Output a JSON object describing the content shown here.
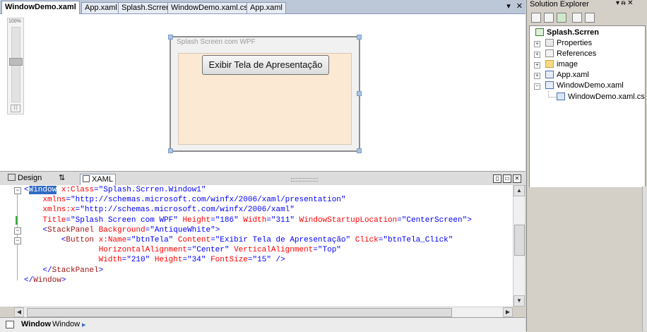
{
  "document_tabs": [
    {
      "label": "WindowDemo.xaml",
      "active": true
    },
    {
      "label": "App.xaml",
      "active": false
    },
    {
      "label": "Splash.Scrren",
      "active": false
    },
    {
      "label": "WindowDemo.xaml.cs",
      "active": false
    },
    {
      "label": "App.xaml",
      "active": false
    }
  ],
  "tab_controls": {
    "dropdown": "▾",
    "close": "✕"
  },
  "designer": {
    "zoom_label": "100%",
    "zoom_fit": "[:]",
    "window_title": "Splash Screen com WPF",
    "button_label": "Exibir Tela de Apresentação",
    "client_color": "#fbe9d4"
  },
  "view_tabs": {
    "design": "Design",
    "swap": "⇅",
    "xaml": "XAML"
  },
  "code": {
    "lines": [
      [
        {
          "t": "<",
          "c": "blue"
        },
        {
          "t": "Window",
          "c": "sel"
        },
        {
          "t": " x:Class",
          "c": "red"
        },
        {
          "t": "=",
          "c": "blue"
        },
        {
          "t": "\"Splash.Scrren.Window1\"",
          "c": "blue"
        }
      ],
      [
        {
          "t": "    xmlns",
          "c": "red"
        },
        {
          "t": "=",
          "c": "blue"
        },
        {
          "t": "\"http://schemas.microsoft.com/winfx/2006/xaml/presentation\"",
          "c": "blue"
        }
      ],
      [
        {
          "t": "    xmlns:x",
          "c": "red"
        },
        {
          "t": "=",
          "c": "blue"
        },
        {
          "t": "\"http://schemas.microsoft.com/winfx/2006/xaml\"",
          "c": "blue"
        }
      ],
      [
        {
          "t": "    Title",
          "c": "red"
        },
        {
          "t": "=",
          "c": "blue"
        },
        {
          "t": "\"Splash Screen com WPF\"",
          "c": "blue"
        },
        {
          "t": " Height",
          "c": "red"
        },
        {
          "t": "=",
          "c": "blue"
        },
        {
          "t": "\"186\"",
          "c": "blue"
        },
        {
          "t": " Width",
          "c": "red"
        },
        {
          "t": "=",
          "c": "blue"
        },
        {
          "t": "\"311\"",
          "c": "blue"
        },
        {
          "t": " WindowStartupLocation",
          "c": "red"
        },
        {
          "t": "=",
          "c": "blue"
        },
        {
          "t": "\"CenterScreen\"",
          "c": "blue"
        },
        {
          "t": ">",
          "c": "blue"
        }
      ],
      [
        {
          "t": "    <",
          "c": "blue"
        },
        {
          "t": "StackPanel",
          "c": "brown"
        },
        {
          "t": " Background",
          "c": "red"
        },
        {
          "t": "=",
          "c": "blue"
        },
        {
          "t": "\"AntiqueWhite\"",
          "c": "blue"
        },
        {
          "t": ">",
          "c": "blue"
        }
      ],
      [
        {
          "t": "        <",
          "c": "blue"
        },
        {
          "t": "Button",
          "c": "brown"
        },
        {
          "t": " x:Name",
          "c": "red"
        },
        {
          "t": "=",
          "c": "blue"
        },
        {
          "t": "\"btnTela\"",
          "c": "blue"
        },
        {
          "t": " Content",
          "c": "red"
        },
        {
          "t": "=",
          "c": "blue"
        },
        {
          "t": "\"Exibir Tela de Apresentação\"",
          "c": "blue"
        },
        {
          "t": " Click",
          "c": "red"
        },
        {
          "t": "=",
          "c": "blue"
        },
        {
          "t": "\"btnTela_Click\"",
          "c": "blue"
        }
      ],
      [
        {
          "t": "                HorizontalAlignment",
          "c": "red"
        },
        {
          "t": "=",
          "c": "blue"
        },
        {
          "t": "\"Center\"",
          "c": "blue"
        },
        {
          "t": " VerticalAlignment",
          "c": "red"
        },
        {
          "t": "=",
          "c": "blue"
        },
        {
          "t": "\"Top\"",
          "c": "blue"
        }
      ],
      [
        {
          "t": "                Width",
          "c": "red"
        },
        {
          "t": "=",
          "c": "blue"
        },
        {
          "t": "\"210\"",
          "c": "blue"
        },
        {
          "t": " Height",
          "c": "red"
        },
        {
          "t": "=",
          "c": "blue"
        },
        {
          "t": "\"34\"",
          "c": "blue"
        },
        {
          "t": " FontSize",
          "c": "red"
        },
        {
          "t": "=",
          "c": "blue"
        },
        {
          "t": "\"15\"",
          "c": "blue"
        },
        {
          "t": " />",
          "c": "blue"
        }
      ],
      [
        {
          "t": "    </",
          "c": "blue"
        },
        {
          "t": "StackPanel",
          "c": "brown"
        },
        {
          "t": ">",
          "c": "blue"
        }
      ],
      [
        {
          "t": "</",
          "c": "blue"
        },
        {
          "t": "Window",
          "c": "brown"
        },
        {
          "t": ">",
          "c": "blue"
        }
      ]
    ]
  },
  "status": {
    "crumb_bold": "Window",
    "crumb_normal": "Window",
    "arrow": "▸"
  },
  "solution_explorer": {
    "title": "Solution Explorer",
    "controls": "▾ ᵰ ✕",
    "project": "Splash.Scrren",
    "items": [
      {
        "label": "Properties",
        "icon": "properties-icon",
        "expander": "+"
      },
      {
        "label": "References",
        "icon": "references-icon",
        "expander": "+"
      },
      {
        "label": "image",
        "icon": "folder-icon",
        "expander": "+"
      },
      {
        "label": "App.xaml",
        "icon": "xaml-file-icon",
        "expander": "+"
      },
      {
        "label": "WindowDemo.xaml",
        "icon": "xaml-file-icon",
        "expander": "−"
      },
      {
        "label": "WindowDemo.xaml.cs",
        "icon": "cs-file-icon",
        "expander": ""
      }
    ]
  }
}
